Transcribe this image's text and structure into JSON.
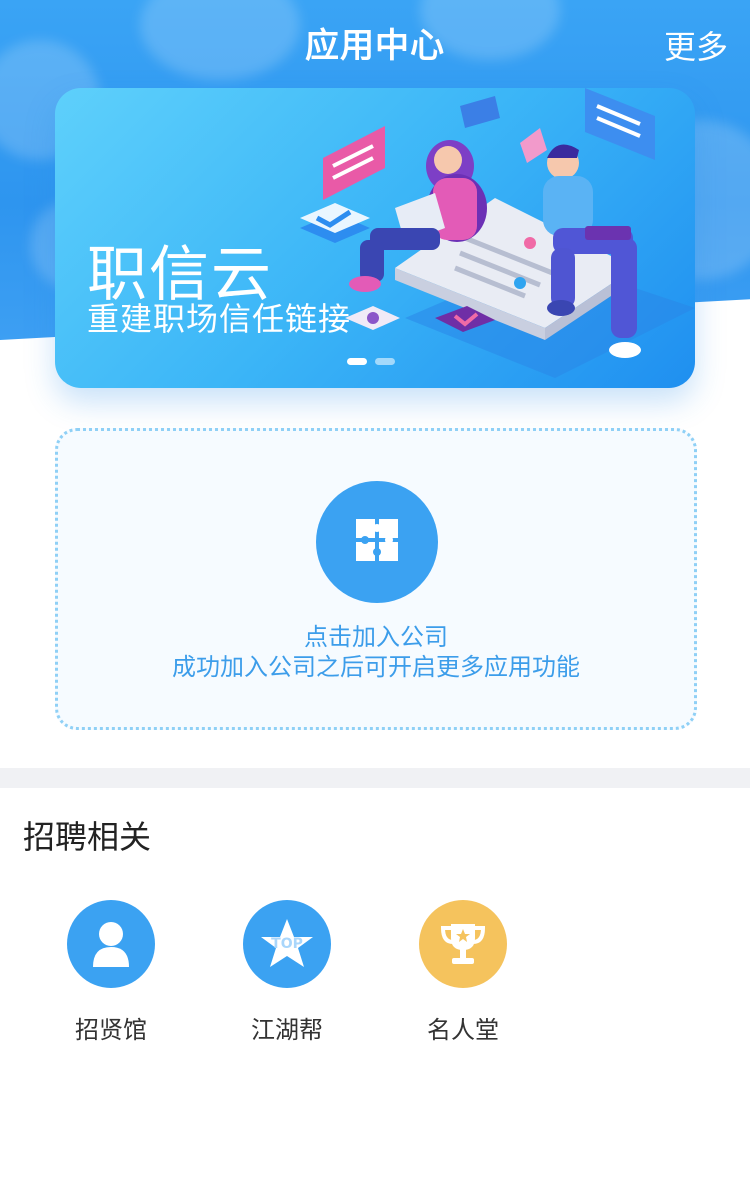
{
  "header": {
    "title": "应用中心",
    "more_label": "更多"
  },
  "banner": {
    "title": "职信云",
    "subtitle": "重建职场信任链接",
    "slides": 2,
    "active_slide": 0
  },
  "join": {
    "icon": "puzzle-icon",
    "line1": "点击加入公司",
    "line2": "成功加入公司之后可开启更多应用功能"
  },
  "recruit": {
    "section_title": "招聘相关",
    "apps": [
      {
        "label": "招贤馆",
        "icon": "user-icon",
        "color": "#3ba2f2"
      },
      {
        "label": "江湖帮",
        "icon": "top-star-icon",
        "color": "#3ba2f2"
      },
      {
        "label": "名人堂",
        "icon": "trophy-icon",
        "color": "#f5c35d"
      }
    ]
  },
  "colors": {
    "primary": "#3ba2f2",
    "accent_gold": "#f5c35d",
    "text_blue": "#3c9dea"
  }
}
